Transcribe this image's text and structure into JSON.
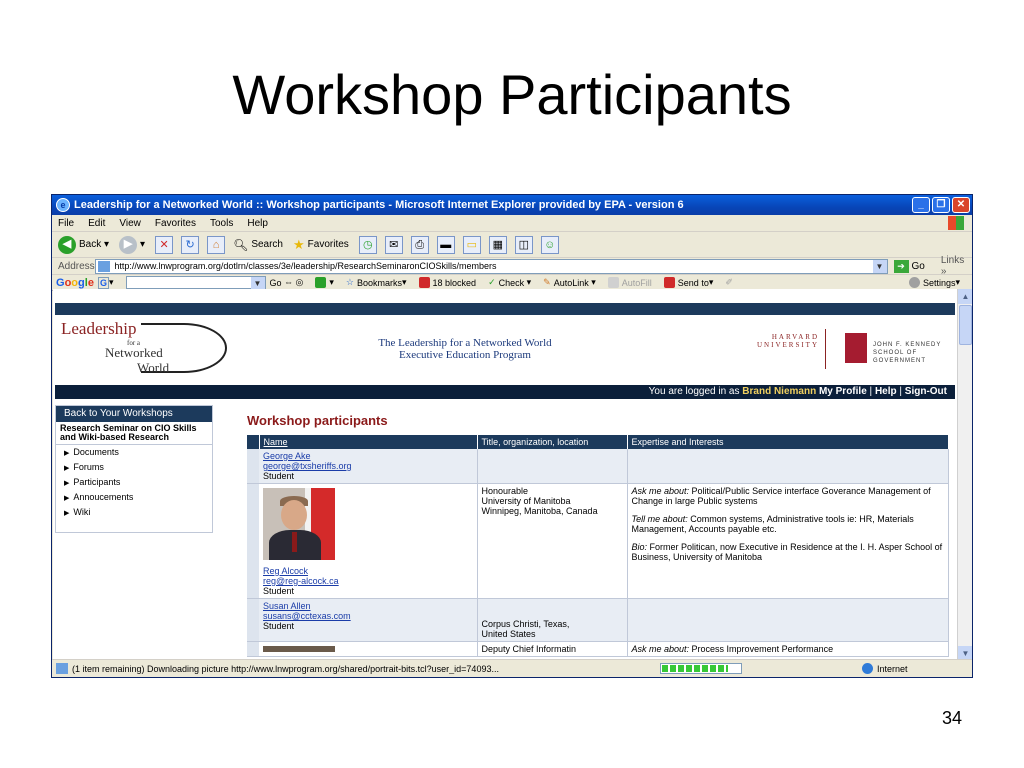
{
  "slide": {
    "title": "Workshop Participants",
    "page_number": "34"
  },
  "window": {
    "title": "Leadership for a Networked World :: Workshop participants - Microsoft Internet Explorer provided by EPA - version 6"
  },
  "menu": [
    "File",
    "Edit",
    "View",
    "Favorites",
    "Tools",
    "Help"
  ],
  "toolbar": {
    "back": "Back",
    "search": "Search",
    "favorites": "Favorites"
  },
  "address": {
    "label": "Address",
    "url": "http://www.lnwprogram.org/dotlrn/classes/3e/leadership/ResearchSeminaronCIOSkills/members",
    "go": "Go",
    "links": "Links"
  },
  "google": {
    "logo": [
      "G",
      "o",
      "o",
      "g",
      "l",
      "e"
    ],
    "go": "Go",
    "bookmarks": "Bookmarks",
    "blocked": "18 blocked",
    "check": "Check",
    "autolink": "AutoLink",
    "autofill": "AutoFill",
    "sendto": "Send to",
    "settings": "Settings"
  },
  "site": {
    "logo_leadership": "Leadership",
    "logo_for": "for a",
    "logo_networked": "Networked",
    "logo_world": "World",
    "program_line1": "The Leadership for a Networked World",
    "program_line2": "Executive Education Program",
    "harvard_line1": "HARVARD",
    "harvard_line2": "UNIVERSITY",
    "ksg_line1": "JOHN F. KENNEDY",
    "ksg_line2": "SCHOOL OF GOVERNMENT",
    "login_prefix": "You are logged in as",
    "login_user": "Brand Niemann",
    "my_profile": "My Profile",
    "help": "Help",
    "sign_out": "Sign-Out",
    "sep": "|"
  },
  "sidebar": {
    "back": "Back to Your Workshops",
    "course": "Research Seminar on CIO Skills and Wiki-based Research",
    "items": [
      "Documents",
      "Forums",
      "Participants",
      "Annoucements",
      "Wiki"
    ]
  },
  "participants": {
    "title": "Workshop participants",
    "headers": [
      "Name",
      "Title, organization, location",
      "Expertise and Interests"
    ],
    "rows": [
      {
        "name": "George Ake",
        "email": "george@txsheriffs.org",
        "role": "Student",
        "org": "",
        "expertise": ""
      },
      {
        "name": "Reg Alcock",
        "email": "reg@reg-alcock.ca",
        "role": "Student",
        "org_title": "Honourable",
        "org_name": "University of Manitoba",
        "org_location": "Winnipeg, Manitoba, Canada",
        "ask_label": "Ask me about:",
        "ask_text": "Political/Public Service interface Goverance Management of Change in large Public systems",
        "tell_label": "Tell me about:",
        "tell_text": "Common systems, Administrative tools ie: HR, Materials Management, Accounts payable etc.",
        "bio_label": "Bio:",
        "bio_text": "Former Politican, now Executive in Residence at the I. H. Asper School of Business, University of Manitoba"
      },
      {
        "name": "Susan Allen",
        "email": "susans@cctexas.com",
        "role": "Student",
        "org_location": "Corpus Christi, Texas,",
        "org_country": "United States"
      },
      {
        "org_title": "Deputy Chief Informatin",
        "ask_label": "Ask me about:",
        "ask_text": "Process Improvement Performance"
      }
    ]
  },
  "status": {
    "text": "(1 item remaining) Downloading picture http://www.lnwprogram.org/shared/portrait-bits.tcl?user_id=74093...",
    "progress": 0.85,
    "zone": "Internet"
  },
  "colors": {
    "titlebar": "#0846b8",
    "site_dark": "#1c3a5c",
    "heading_red": "#8b1a1a",
    "link": "#1a3ca8"
  }
}
